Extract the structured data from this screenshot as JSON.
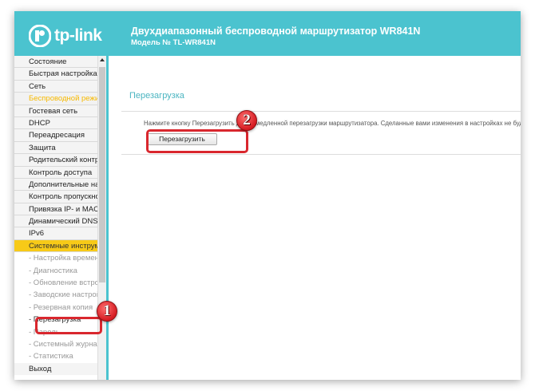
{
  "header": {
    "logo_text": "tp-link",
    "device_title": "Двухдиапазонный беспроводной маршрутизатор WR841N",
    "model": "Модель № TL-WR841N"
  },
  "sidebar": {
    "items": [
      {
        "label": "Состояние"
      },
      {
        "label": "Быстрая настройка"
      },
      {
        "label": "Сеть"
      },
      {
        "label": "Беспроводной режим"
      },
      {
        "label": "Гостевая сеть"
      },
      {
        "label": "DHCP"
      },
      {
        "label": "Переадресация"
      },
      {
        "label": "Защита"
      },
      {
        "label": "Родительский контроль"
      },
      {
        "label": "Контроль доступа"
      },
      {
        "label": "Дополнительные настройки"
      },
      {
        "label": "Контроль пропускной"
      },
      {
        "label": "Привязка IP- и MAC-"
      },
      {
        "label": "Динамический DNS"
      },
      {
        "label": "IPv6"
      },
      {
        "label": "Системные инструменты"
      }
    ],
    "sub_items": [
      {
        "label": "- Настройка времени"
      },
      {
        "label": "- Диагностика"
      },
      {
        "label": "- Обновление встроенного"
      },
      {
        "label": "- Заводские настройки"
      },
      {
        "label": "- Резервная копия"
      },
      {
        "label": "- Перезагрузка"
      },
      {
        "label": "- Пароль"
      },
      {
        "label": "- Системный журнал"
      },
      {
        "label": "- Статистика"
      }
    ],
    "exit_label": "Выход"
  },
  "content": {
    "section_title": "Перезагрузка",
    "notice": "Нажмите кнопку Перезагрузить для немедленной перезагрузки маршрутизатора. Сделанные вами изменения в настройках не будут сохранены",
    "reboot_button_label": "Перезагрузить"
  },
  "annotations": {
    "marker_1": "1",
    "marker_2": "2"
  },
  "colors": {
    "header": "#4bc3cf",
    "active_section": "#f7ca18",
    "highlight": "#d9272e"
  }
}
